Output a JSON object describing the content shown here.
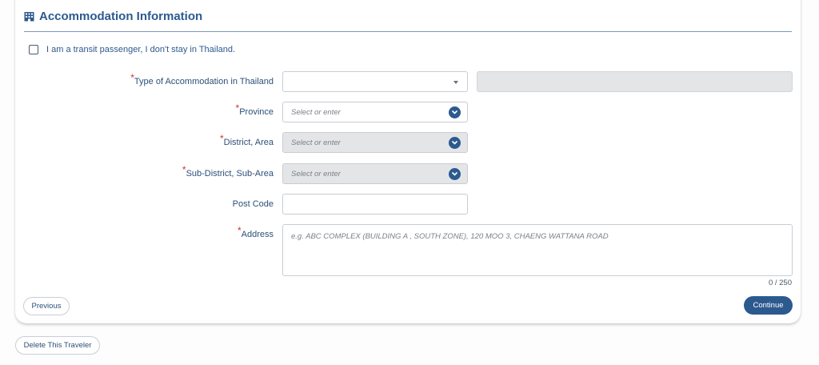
{
  "section": {
    "title": "Accommodation Information",
    "icon": "building-icon"
  },
  "transit": {
    "label": "I am a transit passenger, I don't stay in Thailand.",
    "checked": false
  },
  "fields": {
    "accommodation_type": {
      "label": "Type of Accommodation in Thailand",
      "required": "*",
      "value": ""
    },
    "province": {
      "label": "Province",
      "required": "*",
      "placeholder": "Select or enter"
    },
    "district": {
      "label": "District, Area",
      "required": "*",
      "placeholder": "Select or enter"
    },
    "sub_district": {
      "label": "Sub-District, Sub-Area",
      "required": "*",
      "placeholder": "Select or enter"
    },
    "post_code": {
      "label": "Post Code",
      "value": ""
    },
    "address": {
      "label": "Address",
      "required": "*",
      "placeholder": "e.g. ABC COMPLEX (BUILDING A , SOUTH ZONE), 120 MOO 3, CHAENG WATTANA ROAD",
      "counter": "0 / 250"
    }
  },
  "buttons": {
    "previous": "Previous",
    "continue": "Continue",
    "delete": "Delete This Traveler"
  },
  "colors": {
    "primary": "#2c5a8f",
    "required": "#d32f2f",
    "disabled_bg": "#e4e5e7"
  }
}
